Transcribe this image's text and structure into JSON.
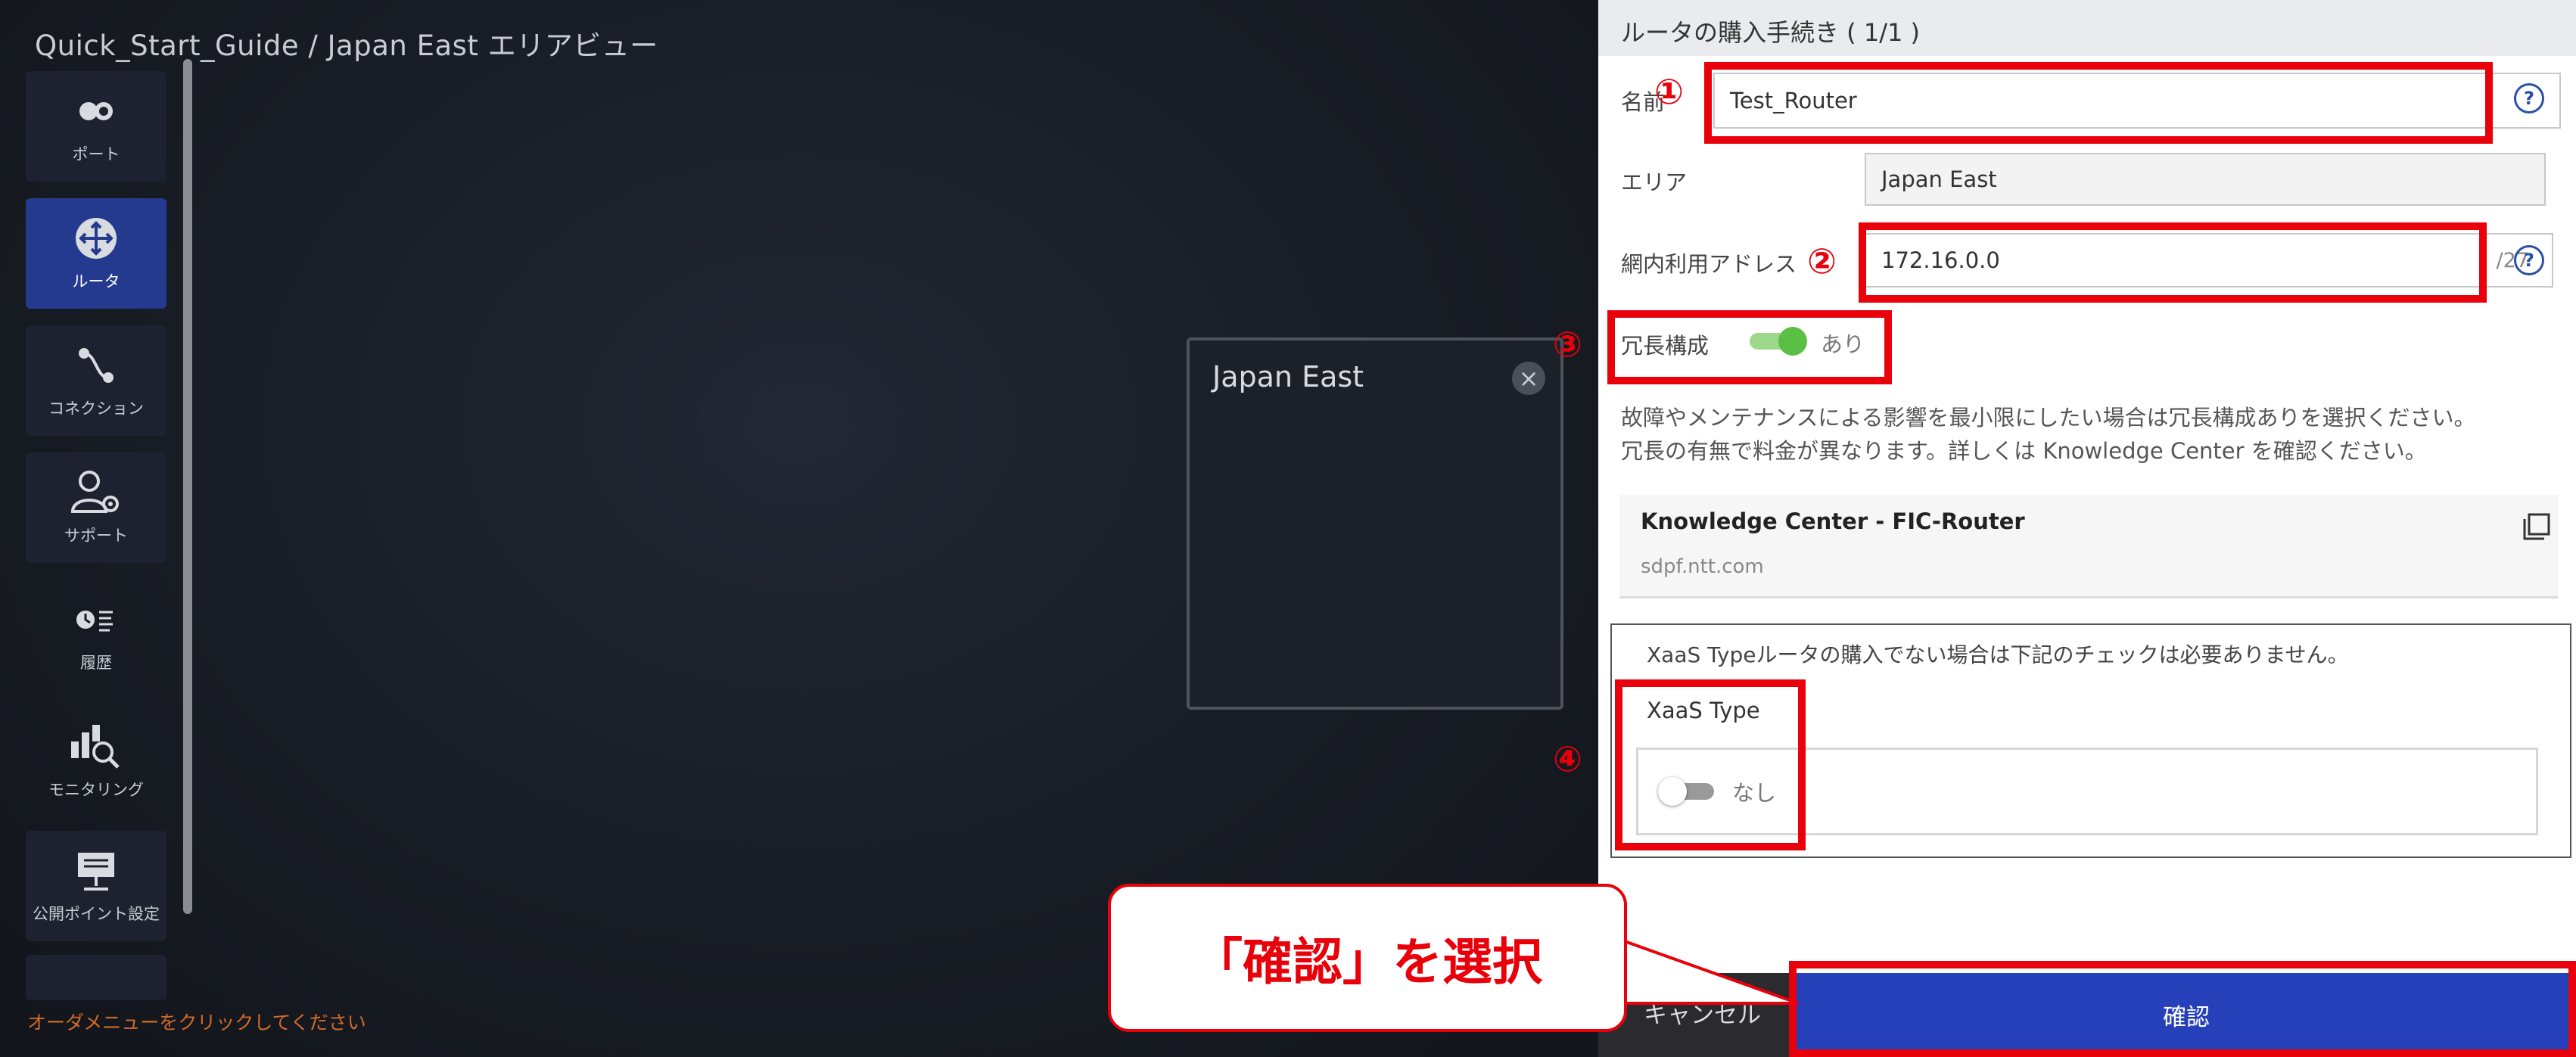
{
  "canvas": {
    "breadcrumb": "Quick_Start_Guide / Japan East エリアビュー",
    "hint": "オーダメニューをクリックしてください",
    "region_title": "Japan East",
    "sidebar": {
      "items": [
        {
          "label": "ポート",
          "icon": "port-icon"
        },
        {
          "label": "ルータ",
          "icon": "router-icon"
        },
        {
          "label": "コネクション",
          "icon": "connection-icon"
        },
        {
          "label": "サポート",
          "icon": "support-icon"
        },
        {
          "label": "履歴",
          "icon": "history-icon"
        },
        {
          "label": "モニタリング",
          "icon": "monitoring-icon"
        },
        {
          "label": "公開ポイント設定",
          "icon": "public-point-icon"
        }
      ]
    }
  },
  "panel": {
    "title": "ルータの購入手続き ( 1/1 )",
    "name_label": "名前",
    "name_value": "Test_Router",
    "area_label": "エリア",
    "area_value": "Japan East",
    "address_label": "網内利用アドレス",
    "address_value": "172.16.0.0",
    "address_suffix": "/27",
    "redundancy_label": "冗長構成",
    "redundancy_value": "あり",
    "desc_line1": "故障やメンテナンスによる影響を最小限にしたい場合は冗長構成ありを選択ください。",
    "desc_line2": "冗長の有無で料金が異なります。詳しくは Knowledge Center を確認ください。",
    "kc_title": "Knowledge Center - FIC-Router",
    "kc_url": "sdpf.ntt.com",
    "xaas_note": "XaaS Typeルータの購入でない場合は下記のチェックは必要ありません。",
    "xaas_label": "XaaS Type",
    "xaas_value": "なし",
    "cancel_label": "キャンセル",
    "confirm_label": "確認"
  },
  "annotations": {
    "num1": "①",
    "num2": "②",
    "num3": "③",
    "num4": "④",
    "callout": "「確認」を選択"
  },
  "colors": {
    "accent": "#2540b8",
    "annotation_red": "#e8000a",
    "toggle_on": "#5cbf45",
    "hint_orange": "#d26b2a"
  }
}
